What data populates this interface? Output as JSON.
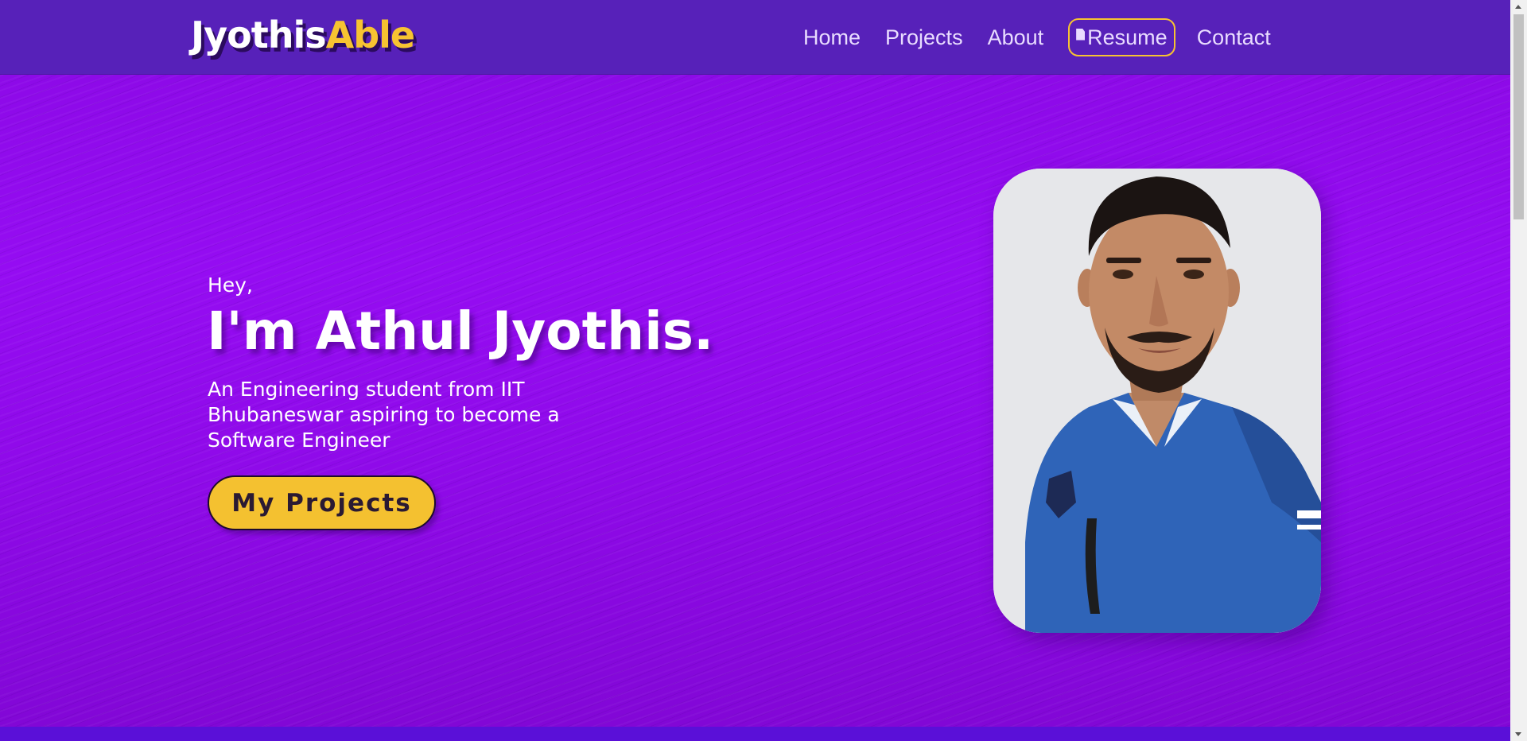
{
  "navbar": {
    "logo_part1": "Jyothis",
    "logo_part2": "Able",
    "links": [
      "Home",
      "Projects",
      "About",
      "Resume",
      "Contact"
    ]
  },
  "hero": {
    "greeting": "Hey,",
    "headline": "I'm Athul Jyothis.",
    "tagline": "An Engineering student from IIT Bhubaneswar aspiring to become a Software Engineer",
    "cta_label": "My Projects"
  },
  "icons": {
    "resume": "document-icon"
  },
  "colors": {
    "navbar_bg": "#5721b9",
    "hero_bg": "#920bee",
    "accent": "#f7c331",
    "text": "#ffffff"
  }
}
